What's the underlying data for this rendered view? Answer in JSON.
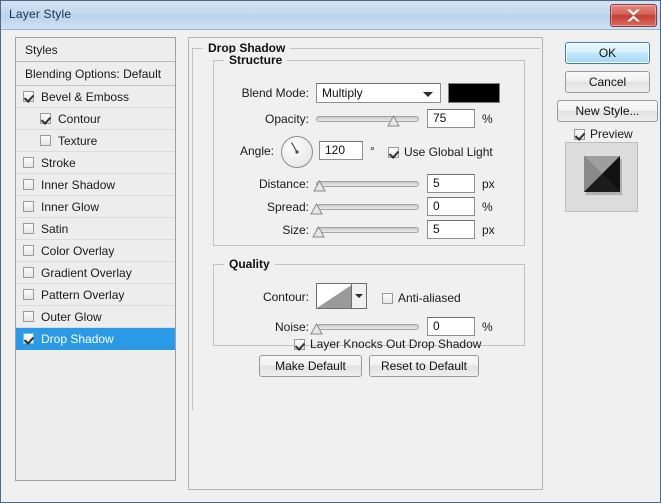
{
  "window": {
    "title": "Layer Style",
    "close_label": "Close"
  },
  "styles_panel": {
    "header": "Styles",
    "blending_options": "Blending Options: Default",
    "effects": [
      {
        "label": "Bevel & Emboss",
        "checked": true,
        "level": 0,
        "selected": false
      },
      {
        "label": "Contour",
        "checked": true,
        "level": 1,
        "selected": false
      },
      {
        "label": "Texture",
        "checked": false,
        "level": 1,
        "selected": false
      },
      {
        "label": "Stroke",
        "checked": false,
        "level": 0,
        "selected": false
      },
      {
        "label": "Inner Shadow",
        "checked": false,
        "level": 0,
        "selected": false
      },
      {
        "label": "Inner Glow",
        "checked": false,
        "level": 0,
        "selected": false
      },
      {
        "label": "Satin",
        "checked": false,
        "level": 0,
        "selected": false
      },
      {
        "label": "Color Overlay",
        "checked": false,
        "level": 0,
        "selected": false
      },
      {
        "label": "Gradient Overlay",
        "checked": false,
        "level": 0,
        "selected": false
      },
      {
        "label": "Pattern Overlay",
        "checked": false,
        "level": 0,
        "selected": false
      },
      {
        "label": "Outer Glow",
        "checked": false,
        "level": 0,
        "selected": false
      },
      {
        "label": "Drop Shadow",
        "checked": true,
        "level": 0,
        "selected": true
      }
    ]
  },
  "main": {
    "group_title": "Drop Shadow",
    "structure": {
      "legend": "Structure",
      "blend_mode_label": "Blend Mode:",
      "blend_mode_value": "Multiply",
      "shadow_color": "#000000",
      "opacity_label": "Opacity:",
      "opacity_value": "75",
      "opacity_unit": "%",
      "opacity_percent": 75,
      "angle_label": "Angle:",
      "angle_value": "120",
      "angle_unit": "°",
      "angle_degrees": 120,
      "use_global_light_label": "Use Global Light",
      "use_global_light_checked": true,
      "distance_label": "Distance:",
      "distance_value": "5",
      "distance_unit": "px",
      "distance_percent": 3,
      "spread_label": "Spread:",
      "spread_value": "0",
      "spread_unit": "%",
      "spread_percent": 0,
      "size_label": "Size:",
      "size_value": "5",
      "size_unit": "px",
      "size_percent": 2
    },
    "quality": {
      "legend": "Quality",
      "contour_label": "Contour:",
      "anti_aliased_label": "Anti-aliased",
      "anti_aliased_checked": false,
      "noise_label": "Noise:",
      "noise_value": "0",
      "noise_unit": "%",
      "noise_percent": 0
    },
    "knockout_label": "Layer Knocks Out Drop Shadow",
    "knockout_checked": true,
    "make_default_label": "Make Default",
    "reset_default_label": "Reset to Default"
  },
  "right": {
    "ok_label": "OK",
    "cancel_label": "Cancel",
    "new_style_label": "New Style...",
    "preview_label": "Preview",
    "preview_checked": true
  },
  "colors": {
    "selection_blue": "#2a9ae6",
    "titlebar_blue": "#c3d9ee",
    "close_red": "#c33f35",
    "dialog_gray": "#f0f0f0"
  }
}
